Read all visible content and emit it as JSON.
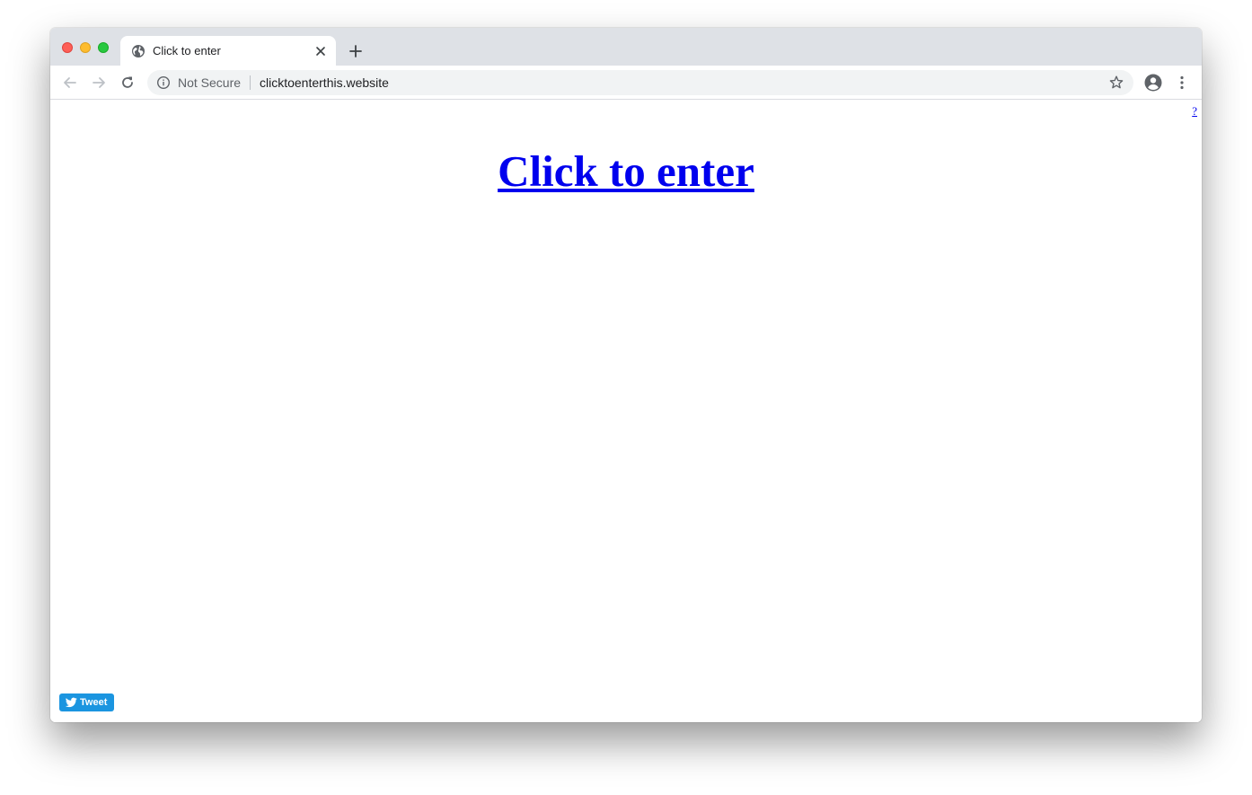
{
  "browser": {
    "tab": {
      "title": "Click to enter",
      "favicon": "globe-icon",
      "close_icon": "close-icon"
    },
    "new_tab_icon": "plus-icon",
    "toolbar": {
      "back_icon": "arrow-left-icon",
      "forward_icon": "arrow-right-icon",
      "reload_icon": "reload-icon",
      "security_label": "Not Secure",
      "url": "clicktoenterthis.website",
      "bookmark_icon": "star-icon",
      "profile_icon": "account-circle-icon",
      "menu_icon": "more-vertical-icon"
    }
  },
  "page": {
    "help_link": "?",
    "main_link": "Click to enter",
    "tweet_button": "Tweet",
    "tweet_icon": "twitter-bird-icon"
  },
  "colors": {
    "link": "#0000ee",
    "tweet_button": "#1b95e0",
    "tabstrip": "#dee1e6",
    "omnibox": "#f1f3f4"
  }
}
